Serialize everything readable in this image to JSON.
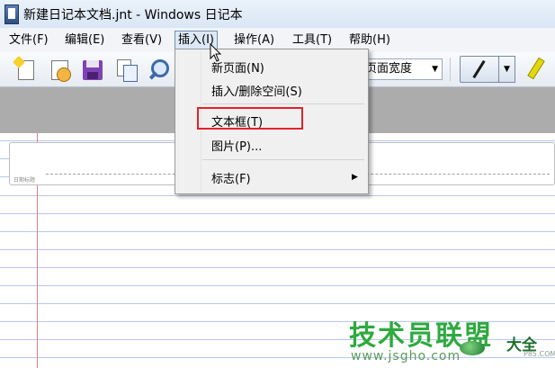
{
  "window": {
    "title": "新建日记本文档.jnt - Windows 日记本"
  },
  "menubar": {
    "items": [
      {
        "label": "文件(F)"
      },
      {
        "label": "编辑(E)"
      },
      {
        "label": "查看(V)"
      },
      {
        "label": "插入(I)"
      },
      {
        "label": "操作(A)"
      },
      {
        "label": "工具(T)"
      },
      {
        "label": "帮助(H)"
      }
    ],
    "active_index": 3
  },
  "toolbar": {
    "width_select_value": "页面宽度",
    "icons": [
      "new-page-icon",
      "clock-icon",
      "save-icon",
      "copy-icon",
      "find-icon",
      "pen-icon",
      "highlighter-icon"
    ],
    "highlighter_color": "#e2d80e"
  },
  "insert_menu": {
    "items": [
      {
        "label": "新页面(N)"
      },
      {
        "label": "插入/删除空间(S)"
      },
      {
        "label": "文本框(T)",
        "highlighted": true
      },
      {
        "label": "图片(P)..."
      },
      {
        "label": "标志(F)",
        "has_submenu": true
      }
    ],
    "highlight_color": "#e2222a"
  },
  "page": {
    "date_caption": "日期标题",
    "rule_color": "#b7c7ef",
    "margin_color": "#e08080"
  },
  "watermark": {
    "main": "技术员联盟",
    "suffix": "大全",
    "url": "www.jsgho.com",
    "small": "P85.COM"
  }
}
